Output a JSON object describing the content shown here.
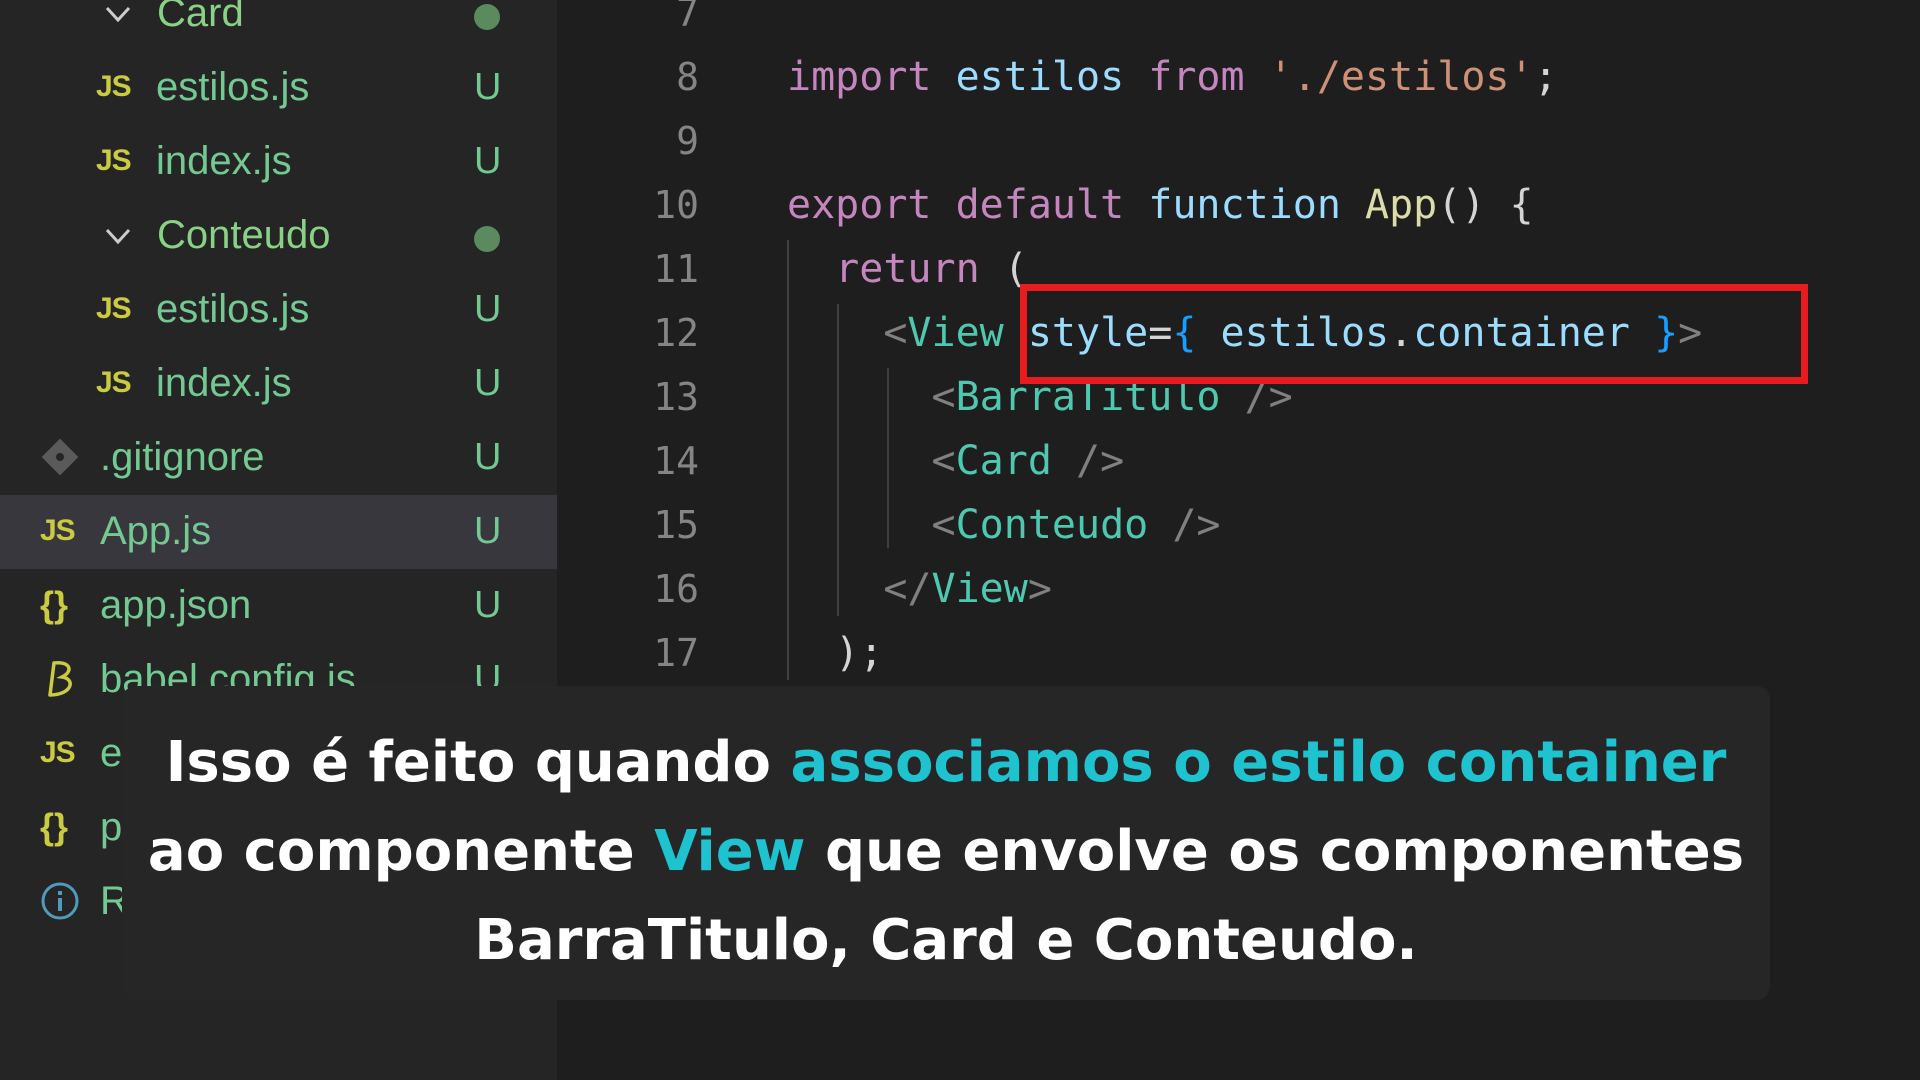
{
  "explorer": {
    "items": [
      {
        "kind": "folder",
        "name": "Card",
        "indent": 1
      },
      {
        "kind": "file",
        "icon": "JS",
        "name": "estilos.js",
        "status": "U",
        "indent": 2
      },
      {
        "kind": "file",
        "icon": "JS",
        "name": "index.js",
        "status": "U",
        "indent": 2
      },
      {
        "kind": "folder",
        "name": "Conteudo",
        "indent": 1
      },
      {
        "kind": "file",
        "icon": "JS",
        "name": "estilos.js",
        "status": "U",
        "indent": 2
      },
      {
        "kind": "file",
        "icon": "JS",
        "name": "index.js",
        "status": "U",
        "indent": 2
      },
      {
        "kind": "file",
        "icon": "git-icon",
        "name": ".gitignore",
        "status": "U",
        "indent": 0
      },
      {
        "kind": "file",
        "icon": "JS",
        "name": "App.js",
        "status": "U",
        "indent": 0,
        "active": true
      },
      {
        "kind": "file",
        "icon": "{}",
        "name": "app.json",
        "status": "U",
        "indent": 0
      },
      {
        "kind": "file",
        "icon": "babel-icon",
        "name": "babel.config.js",
        "status": "U",
        "indent": 0
      },
      {
        "kind": "file",
        "icon": "JS",
        "name": "est",
        "status": "",
        "indent": 0
      },
      {
        "kind": "file",
        "icon": "{}",
        "name": "pa",
        "status": "",
        "indent": 0
      },
      {
        "kind": "file",
        "icon": "info-icon",
        "name": "RE",
        "status": "",
        "indent": 0
      }
    ]
  },
  "editor": {
    "lines": [
      {
        "n": "7",
        "tokens": []
      },
      {
        "n": "8",
        "tokens": [
          [
            "kw",
            "import"
          ],
          [
            "p",
            " "
          ],
          [
            "v",
            "estilos"
          ],
          [
            "p",
            " "
          ],
          [
            "kw",
            "from"
          ],
          [
            "p",
            " "
          ],
          [
            "s",
            "'./estilos'"
          ],
          [
            "p",
            ";"
          ]
        ]
      },
      {
        "n": "9",
        "tokens": []
      },
      {
        "n": "10",
        "tokens": [
          [
            "kw",
            "export"
          ],
          [
            "p",
            " "
          ],
          [
            "kw",
            "default"
          ],
          [
            "p",
            " "
          ],
          [
            "v",
            "function"
          ],
          [
            "p",
            " "
          ],
          [
            "fn",
            "App"
          ],
          [
            "p",
            "() {"
          ]
        ]
      },
      {
        "n": "11",
        "tokens": [
          [
            "p",
            "  "
          ],
          [
            "kw",
            "return"
          ],
          [
            "p",
            " ("
          ]
        ]
      },
      {
        "n": "12",
        "tokens": [
          [
            "p",
            "    "
          ],
          [
            "br",
            "<"
          ],
          [
            "tag",
            "View"
          ],
          [
            "p",
            " "
          ],
          [
            "attr",
            "style"
          ],
          [
            "p",
            "="
          ],
          [
            "br3",
            "{"
          ],
          [
            "p",
            " "
          ],
          [
            "v",
            "estilos"
          ],
          [
            "p",
            "."
          ],
          [
            "v",
            "container"
          ],
          [
            "p",
            " "
          ],
          [
            "br3",
            "}"
          ],
          [
            "br",
            ">"
          ]
        ]
      },
      {
        "n": "13",
        "tokens": [
          [
            "p",
            "      "
          ],
          [
            "br",
            "<"
          ],
          [
            "tag",
            "BarraTitulo"
          ],
          [
            "p",
            " "
          ],
          [
            "br",
            "/>"
          ]
        ]
      },
      {
        "n": "14",
        "tokens": [
          [
            "p",
            "      "
          ],
          [
            "br",
            "<"
          ],
          [
            "tag",
            "Card"
          ],
          [
            "p",
            " "
          ],
          [
            "br",
            "/>"
          ]
        ]
      },
      {
        "n": "15",
        "tokens": [
          [
            "p",
            "      "
          ],
          [
            "br",
            "<"
          ],
          [
            "tag",
            "Conteudo"
          ],
          [
            "p",
            " "
          ],
          [
            "br",
            "/>"
          ]
        ]
      },
      {
        "n": "16",
        "tokens": [
          [
            "p",
            "    "
          ],
          [
            "br",
            "</"
          ],
          [
            "tag",
            "View"
          ],
          [
            "br",
            ">"
          ]
        ]
      },
      {
        "n": "17",
        "tokens": [
          [
            "p",
            "  );"
          ]
        ]
      }
    ]
  },
  "caption": {
    "parts": [
      {
        "text": "Isso é feito quando ",
        "highlight": false
      },
      {
        "text": "associamos o estilo container",
        "highlight": true
      },
      {
        "text": " ao componente ",
        "highlight": false
      },
      {
        "text": "View",
        "highlight": true
      },
      {
        "text": " que envolve os componentes BarraTitulo, Card e Conteudo.",
        "highlight": false
      }
    ]
  },
  "colors": {
    "highlight_box": "#e81b1f",
    "caption_accent": "#1fc2cf",
    "untracked": "#73c991"
  }
}
